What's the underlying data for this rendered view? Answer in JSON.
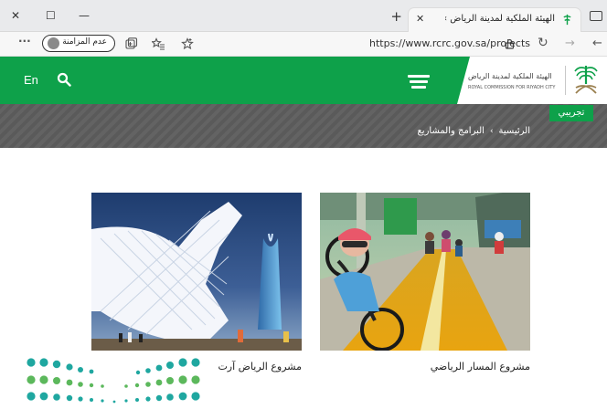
{
  "browser": {
    "window_controls": {
      "close": "✕",
      "maximize": "☐",
      "minimize": "—"
    },
    "tab": {
      "title": "الهيئة الملكية لمدينة الرياض » البرا",
      "close": "✕"
    },
    "new_tab": "+",
    "address": {
      "url": "https://www.rcrc.gov.sa/projects"
    },
    "profile": {
      "label": "عدم المزامنة"
    },
    "icons": [
      "back-icon",
      "forward-icon",
      "refresh-icon",
      "lock-icon",
      "favorites-star-icon",
      "collections-icon",
      "more-icon"
    ],
    "nav": {
      "back": "←",
      "forward": "→",
      "refresh": "↻",
      "more": "···"
    }
  },
  "site": {
    "lang_link": "En",
    "logo": {
      "name_ar": "الهيئة الملكية لمدينة الرياض",
      "name_en": "ROYAL COMMISSION FOR RIYADH CITY"
    },
    "beta_label": "تجريبي",
    "breadcrumb": {
      "home": "الرئيسية",
      "separator": "›",
      "current": "البرامج والمشاريع"
    },
    "projects": [
      {
        "title": "مشروع المسار الرياضي"
      },
      {
        "title": "مشروع الرياض آرت"
      }
    ],
    "colors": {
      "brand_green": "#0ea14a",
      "band_gray": "#5a5a5a",
      "accent_blue": "#1ea4dc"
    }
  }
}
